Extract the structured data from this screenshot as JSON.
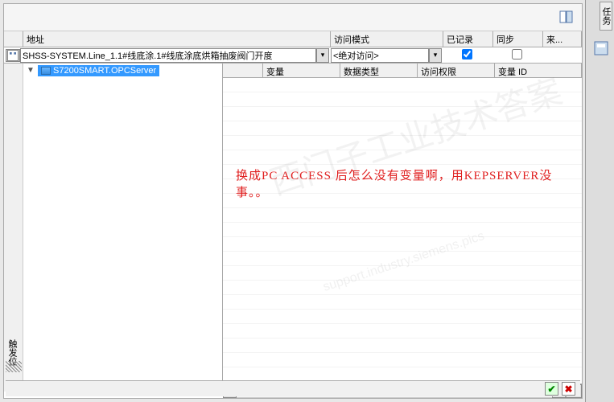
{
  "right_tab": "任务",
  "headers": {
    "address": "地址",
    "access_mode": "访问模式",
    "logged": "已记录",
    "sync": "同步",
    "source": "来..."
  },
  "input": {
    "address_value": "SHSS-SYSTEM.Line_1.1#线底涂.1#线底涂底烘箱抽废阀门开度",
    "access_mode_value": "<绝对访问>",
    "logged_checked": true,
    "sync_checked": false
  },
  "tree": {
    "item": "S7200SMART.OPCServer"
  },
  "grid_headers": {
    "variable": "变量",
    "datatype": "数据类型",
    "access": "访问权限",
    "var_id": "变量 ID"
  },
  "annotation": "换成PC  ACCESS 后怎么没有变量啊，用KEPSERVER没事。。",
  "watermark1": "西门子工业技术答案",
  "watermark2": "support.industry.siemens.pics",
  "left_label": "触发位",
  "scroll_handle_axis": "|||"
}
